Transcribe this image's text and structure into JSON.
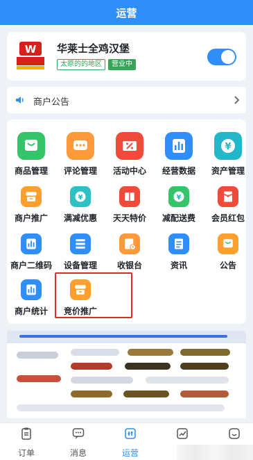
{
  "header": {
    "title": "运营"
  },
  "store": {
    "name": "华莱士全鸡汉堡",
    "area_tag": "太原的的地区",
    "status_tag": "营业中",
    "logo_text": "华莱士",
    "toggle_on": true,
    "colors": {
      "brand_red": "#d6201c",
      "status_green": "#3aa35a",
      "accent": "#2f8ef7"
    }
  },
  "notice": {
    "label": "商户公告",
    "icon": "speaker-icon"
  },
  "tiles": [
    {
      "label": "商品管理",
      "icon": "bag-icon",
      "color": "#35c46a"
    },
    {
      "label": "评论管理",
      "icon": "comment-icon",
      "color": "#ff9a3c"
    },
    {
      "label": "活动中心",
      "icon": "coupon-icon",
      "color": "#f04a3a"
    },
    {
      "label": "经营数据",
      "icon": "bar-chart-icon",
      "color": "#2f8ef7"
    },
    {
      "label": "资产管理",
      "icon": "yen-icon",
      "color": "#25b7c9"
    },
    {
      "label": "商户推广",
      "icon": "store-icon",
      "color": "#ff9f2e"
    },
    {
      "label": "满减优惠",
      "icon": "yen-icon",
      "color": "#2fc0c6"
    },
    {
      "label": "天天特价",
      "icon": "ticket-icon",
      "color": "#f04a3a"
    },
    {
      "label": "减配送费",
      "icon": "yen-icon",
      "color": "#35c46a"
    },
    {
      "label": "会员红包",
      "icon": "red-envelope-icon",
      "color": "#f04a3a"
    },
    {
      "label": "商户二维码",
      "icon": "bar-chart-icon",
      "color": "#2f8ef7"
    },
    {
      "label": "设备管理",
      "icon": "list-icon",
      "color": "#2f8ef7"
    },
    {
      "label": "收银台",
      "icon": "clock-doc-icon",
      "color": "#ff9a3c"
    },
    {
      "label": "资讯",
      "icon": "document-icon",
      "color": "#2f8ef7"
    },
    {
      "label": "公告",
      "icon": "bag-icon",
      "color": "#ff9f2e"
    },
    {
      "label": "商户统计",
      "icon": "bar-chart-icon",
      "color": "#2f8ef7"
    },
    {
      "label": "竞价推广",
      "icon": "store-icon",
      "color": "#ff9f2e"
    }
  ],
  "nav": [
    {
      "label": "订单",
      "icon": "clipboard-icon"
    },
    {
      "label": "消息",
      "icon": "chat-icon"
    },
    {
      "label": "运营",
      "icon": "operations-icon",
      "active": true
    },
    {
      "label": "",
      "icon": "trend-icon"
    },
    {
      "label": "",
      "icon": "smile-icon"
    }
  ]
}
